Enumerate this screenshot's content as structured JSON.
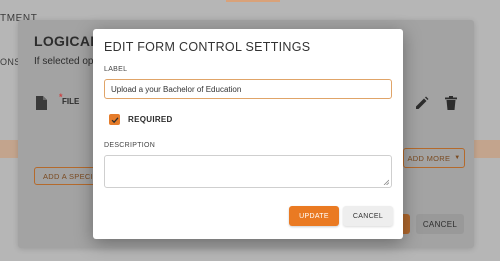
{
  "background": {
    "heading_fragment": "TMENT",
    "line_fragment": "ONSE",
    "card": {
      "title": "LOGICAL ST",
      "subtitle": "If selected op",
      "file_label": "FILE",
      "required_marker": "*",
      "add_more_label": "ADD MORE",
      "add_specific_label": "ADD A SPECIFIC",
      "cancel_label": "CANCEL"
    }
  },
  "modal": {
    "title": "EDIT FORM CONTROL SETTINGS",
    "label_field": {
      "label": "LABEL",
      "value": "Upload a your Bachelor of Education"
    },
    "required": {
      "label": "REQUIRED",
      "checked": true
    },
    "description_field": {
      "label": "DESCRIPTION",
      "value": ""
    },
    "buttons": {
      "update": "UPDATE",
      "cancel": "CANCEL"
    }
  },
  "colors": {
    "accent": "#ea7a22",
    "accent_border": "#e0a468",
    "overlay": "#8e8e8e"
  },
  "icons": [
    "file-icon",
    "edit-icon",
    "delete-icon",
    "chevron-down-icon",
    "check-icon",
    "resize-grip-icon"
  ]
}
